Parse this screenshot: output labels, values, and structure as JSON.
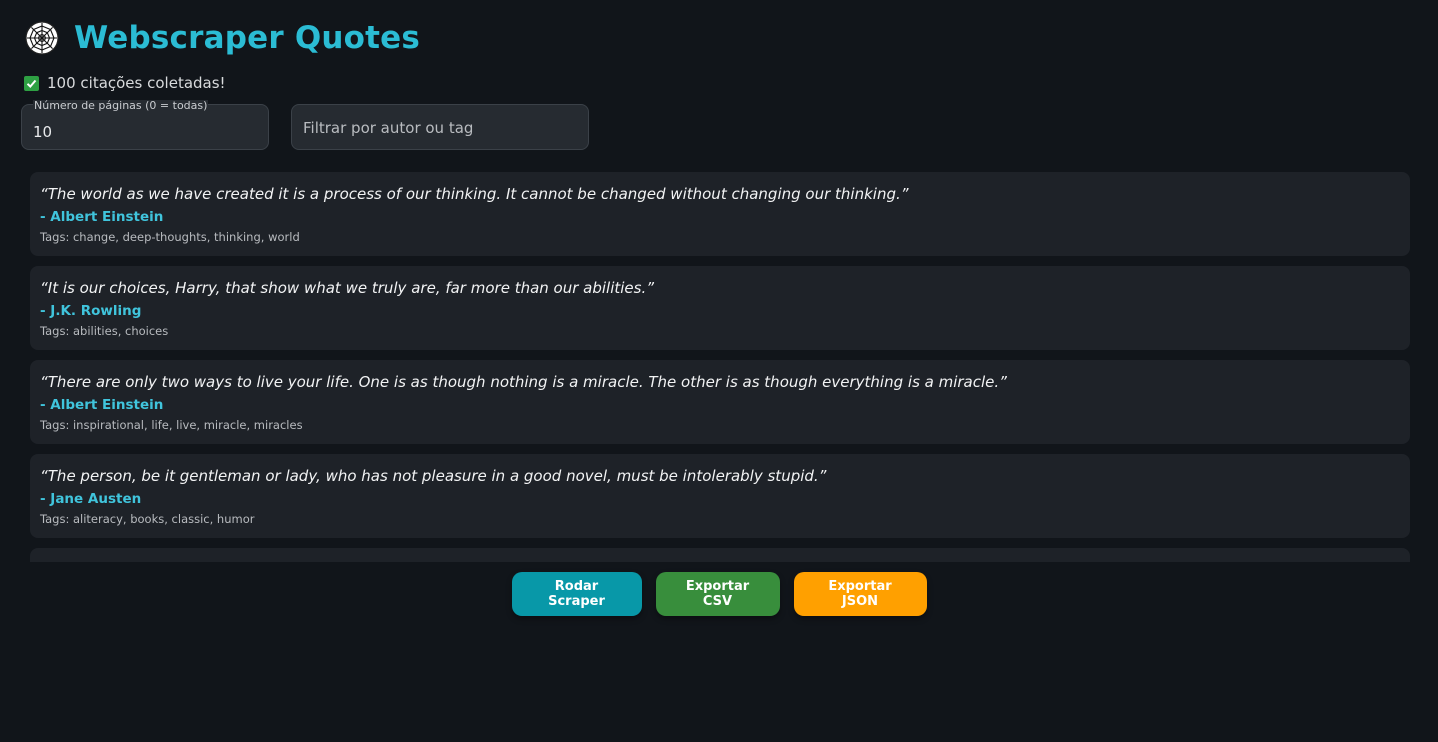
{
  "app": {
    "title": "Webscraper Quotes",
    "logo_icon": "spider-web-icon",
    "accent_color": "#2bbcd4"
  },
  "status": {
    "icon": "check-icon",
    "text": "100 citações coletadas!"
  },
  "inputs": {
    "pages_label": "Número de páginas (0 = todas)",
    "pages_value": "10",
    "filter_placeholder": "Filtrar por autor ou tag",
    "filter_value": ""
  },
  "quotes": [
    {
      "text": "“The world as we have created it is a process of our thinking. It cannot be changed without changing our thinking.”",
      "author": "- Albert Einstein",
      "tags": "Tags: change, deep-thoughts, thinking, world"
    },
    {
      "text": "“It is our choices, Harry, that show what we truly are, far more than our abilities.”",
      "author": "- J.K. Rowling",
      "tags": "Tags: abilities, choices"
    },
    {
      "text": "“There are only two ways to live your life. One is as though nothing is a miracle. The other is as though everything is a miracle.”",
      "author": "- Albert Einstein",
      "tags": "Tags: inspirational, life, live, miracle, miracles"
    },
    {
      "text": "“The person, be it gentleman or lady, who has not pleasure in a good novel, must be intolerably stupid.”",
      "author": "- Jane Austen",
      "tags": "Tags: aliteracy, books, classic, humor"
    },
    {
      "text": "",
      "author": "",
      "tags": ""
    }
  ],
  "buttons": {
    "run": {
      "label": "Rodar Scraper",
      "color": "#0898a8"
    },
    "csv": {
      "label": "Exportar CSV",
      "color": "#388e3c"
    },
    "json": {
      "label": "Exportar JSON",
      "color": "#ffa000"
    }
  }
}
